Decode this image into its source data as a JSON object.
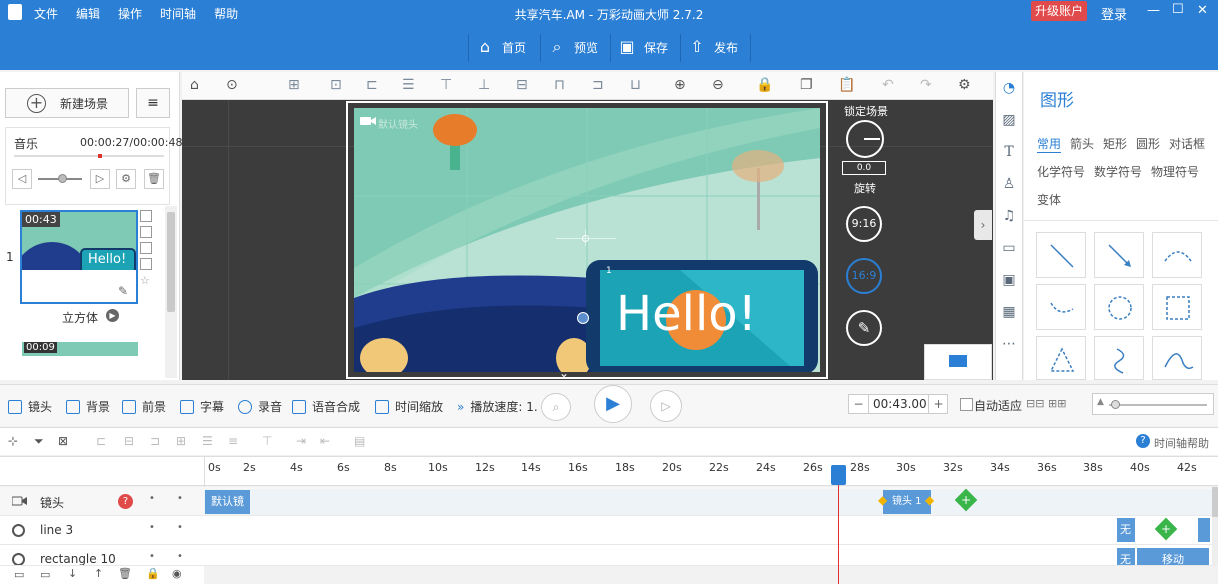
{
  "app": {
    "title": "共享汽车.AM - 万彩动画大师 2.7.2",
    "menu": [
      "文件",
      "编辑",
      "操作",
      "时间轴",
      "帮助"
    ],
    "upgrade": "升级账户",
    "login": "登录"
  },
  "toolbar": {
    "home": "首页",
    "preview": "预览",
    "save": "保存",
    "publish": "发布"
  },
  "scene_panel": {
    "new_scene": "新建场景",
    "music_label": "音乐",
    "music_time": "00:00:27/00:00:48",
    "scene1_time": "00:43",
    "scene1_index": "1",
    "scene1_transition": "立方体",
    "scene2_time": "00:09"
  },
  "stage": {
    "camera_label": "默认镜头",
    "hello_text": "Hello!",
    "element_label": "1"
  },
  "stage_panel": {
    "lock_scene": "锁定场景",
    "rotate_value": "0.0",
    "rotate_label": "旋转",
    "ratio_916": "9:16",
    "ratio_169": "16:9"
  },
  "shapes": {
    "title": "图形",
    "tabs_row1": [
      "常用",
      "箭头",
      "矩形",
      "圆形",
      "对话框"
    ],
    "tabs_row2": [
      "化学符号",
      "数学符号",
      "物理符号"
    ],
    "tabs_row3": [
      "变体"
    ]
  },
  "timeline": {
    "camera": "镜头",
    "background": "背景",
    "foreground": "前景",
    "subtitle": "字幕",
    "record": "录音",
    "tts": "语音合成",
    "time_scale": "时间缩放",
    "speed": "播放速度: 1.",
    "time_value": "00:43.00",
    "auto_fit": "自动适应",
    "help": "时间轴帮助",
    "ticks": [
      "0s",
      "2s",
      "4s",
      "6s",
      "8s",
      "10s",
      "12s",
      "14s",
      "16s",
      "18s",
      "20s",
      "22s",
      "24s",
      "26s",
      "28s",
      "30s",
      "32s",
      "34s",
      "36s",
      "38s",
      "40s",
      "42s"
    ],
    "tracks": [
      {
        "name": "镜头",
        "clip": "默认镜",
        "clip2": "镜头 1"
      },
      {
        "name": "line 3",
        "clip": "无"
      },
      {
        "name": "rectangle 10",
        "clip": "无",
        "clip2": "移动"
      }
    ]
  },
  "colors": {
    "accent": "#2b7fd4",
    "upgrade": "#e14a4a",
    "playhead": "#e03030"
  }
}
